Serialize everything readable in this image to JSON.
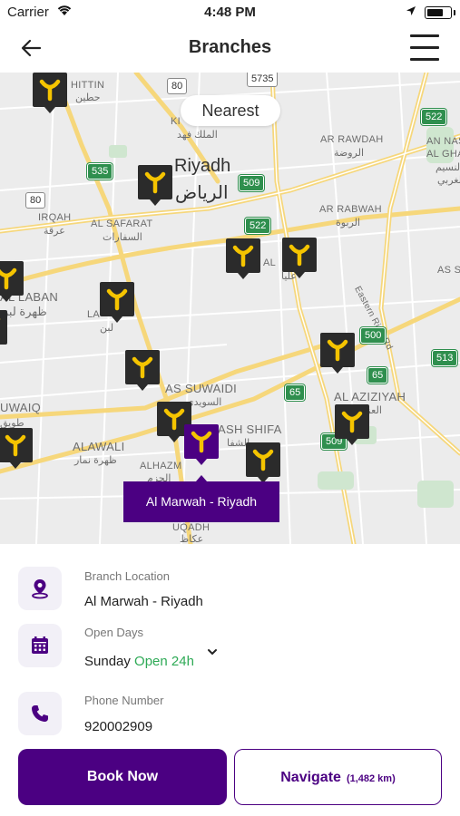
{
  "status_bar": {
    "carrier": "Carrier",
    "time": "4:48 PM"
  },
  "header": {
    "title": "Branches"
  },
  "map": {
    "nearest_button": "Nearest",
    "selected_callout": "Al Marwah - Riyadh",
    "labels": [
      "HITTIN",
      "حطين",
      "KI",
      "الملك فهد",
      "Riyadh",
      "الرياض",
      "AR RAWDAH",
      "الروضة",
      "AN NAS",
      "AL GHA",
      "النسيم",
      "الغربي",
      "IRQAH",
      "عرقة",
      "AL SAFARAT",
      "السفارات",
      "AR RABWAH",
      "الربوة",
      "Eastern Ring Rd",
      "AS SU",
      "AL LABAN",
      "ظهرة لبن",
      "LA",
      "لبن",
      "AL",
      "عليا",
      "AS SUWAIDI",
      "السويدي",
      "AL AZIZIYAH",
      "العزيزية",
      "UWAIQ",
      "طويق",
      "ALAWALI",
      "ظهرة نمار",
      "ASH SHIFA",
      "الشفا",
      "ALHAZM",
      "الحزم",
      "UQADH",
      "عكاظ"
    ],
    "road_shields": [
      "5735",
      "80",
      "522",
      "535",
      "509",
      "80",
      "522",
      "500",
      "65",
      "65",
      "513",
      "509"
    ]
  },
  "branch": {
    "location_label": "Branch Location",
    "location_value": "Al Marwah - Riyadh",
    "days_label": "Open Days",
    "days_value": "Sunday",
    "days_status": "Open 24h",
    "phone_label": "Phone Number",
    "phone_value": "920002909"
  },
  "actions": {
    "book_label": "Book Now",
    "navigate_label": "Navigate",
    "navigate_distance": "(1,482 km)"
  },
  "colors": {
    "brand": "#4b0082",
    "open_status": "#2eaa56",
    "pin": "#2b2b2b",
    "pin_icon": "#f5c400"
  }
}
